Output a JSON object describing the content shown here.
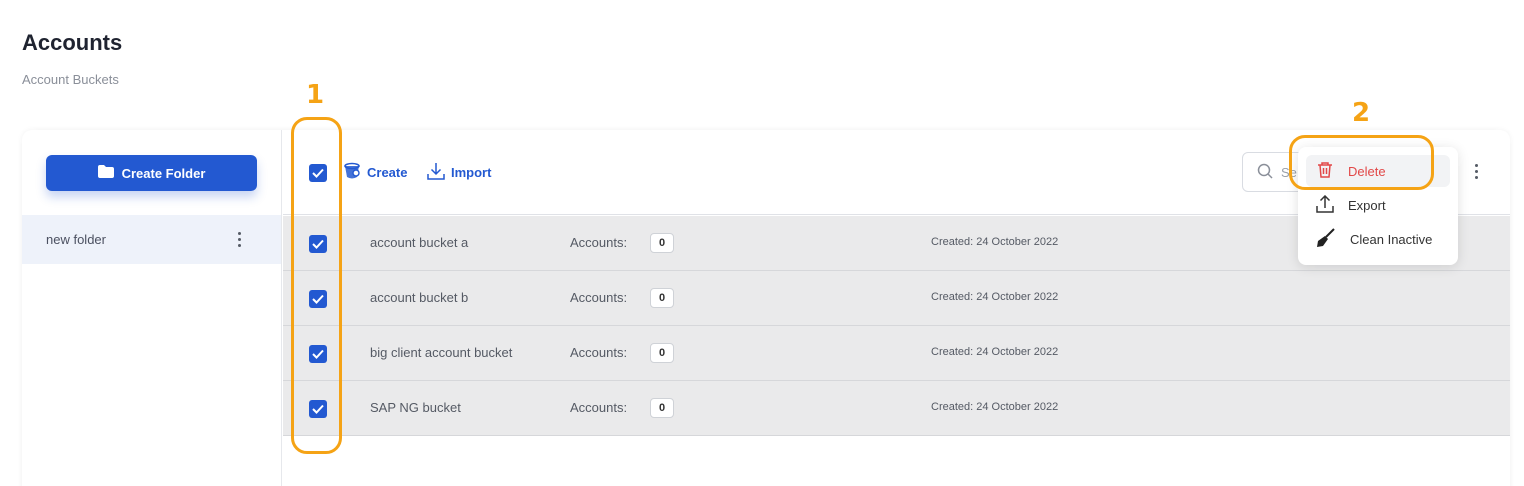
{
  "page": {
    "title": "Accounts",
    "subtitle": "Account Buckets"
  },
  "sidebar": {
    "create_folder_label": "Create Folder",
    "folders": [
      {
        "label": "new folder"
      }
    ]
  },
  "toolbar": {
    "create_label": "Create",
    "import_label": "Import",
    "search_placeholder": "Se"
  },
  "buckets": [
    {
      "name": "account bucket a",
      "accounts_label": "Accounts:",
      "count": "0",
      "created": "Created: 24 October 2022",
      "checked": true
    },
    {
      "name": "account bucket b",
      "accounts_label": "Accounts:",
      "count": "0",
      "created": "Created: 24 October 2022",
      "checked": true
    },
    {
      "name": "big client account bucket",
      "accounts_label": "Accounts:",
      "count": "0",
      "created": "Created: 24 October 2022",
      "checked": true
    },
    {
      "name": "SAP NG bucket",
      "accounts_label": "Accounts:",
      "count": "0",
      "created": "Created: 24 October 2022",
      "checked": true
    }
  ],
  "menu": {
    "items": [
      {
        "label": "Delete",
        "icon": "trash-icon"
      },
      {
        "label": "Export",
        "icon": "upload-icon"
      },
      {
        "label": "Clean Inactive",
        "icon": "broom-icon"
      }
    ]
  },
  "annotations": {
    "one": "1",
    "two": "2"
  },
  "colors": {
    "accent": "#2359d1",
    "annotation": "#f5a315",
    "danger": "#e24848",
    "row_bg": "#eaeaeb"
  }
}
